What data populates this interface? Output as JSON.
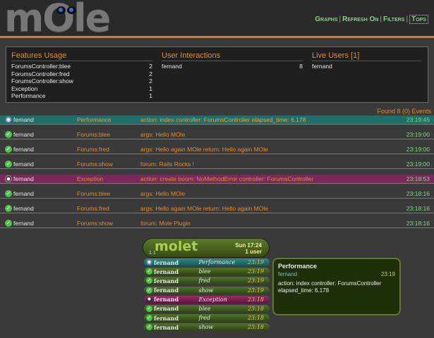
{
  "header": {
    "logo": "mOle",
    "nav": [
      "Graphs",
      "Refresh On",
      "Filters",
      "Tops"
    ]
  },
  "summary": {
    "features": {
      "title": "Features Usage",
      "items": [
        {
          "name": "ForumsController:blee",
          "count": "2"
        },
        {
          "name": "ForumsController:fred",
          "count": "2"
        },
        {
          "name": "ForumsController:show",
          "count": "2"
        },
        {
          "name": "Exception",
          "count": "1"
        },
        {
          "name": "Performance",
          "count": "1"
        }
      ]
    },
    "interactions": {
      "title": "User Interactions",
      "items": [
        {
          "name": "fernand",
          "count": "8"
        }
      ]
    },
    "live": {
      "title": "Live Users [1]",
      "items": [
        {
          "name": "fernand"
        }
      ]
    }
  },
  "found": "Found 8 (0) Events",
  "events": [
    {
      "kind": "perf",
      "user": "fernand",
      "type": "Performance",
      "msg": "action: index controller: ForumsController elapsed_time: 6.178",
      "time": "23:19:45"
    },
    {
      "kind": "ok",
      "user": "fernand",
      "type": "Forums:blee",
      "msg": "args: Hello MOle",
      "time": "23:19:00"
    },
    {
      "kind": "ok",
      "user": "fernand",
      "type": "Forums:fred",
      "msg": "args: Hello again MOle return: Hello again MOle",
      "time": "23:19:00"
    },
    {
      "kind": "ok",
      "user": "fernand",
      "type": "Forums:show",
      "msg": "forum: Rails Rocks !",
      "time": "23:19:00"
    },
    {
      "kind": "exc",
      "user": "fernand",
      "type": "Exception",
      "msg": "action: create boom: NoMethodError controller: ForumsController",
      "time": "23:18:53"
    },
    {
      "kind": "ok",
      "user": "fernand",
      "type": "Forums:blee",
      "msg": "args: Hello MOle",
      "time": "23:18:16"
    },
    {
      "kind": "ok",
      "user": "fernand",
      "type": "Forums:fred",
      "msg": "args: Hello again MOle return: Hello again MOle",
      "time": "23:18:16"
    },
    {
      "kind": "ok",
      "user": "fernand",
      "type": "Forums:show",
      "msg": "forum: Mole Plugin",
      "time": "23:18:16"
    }
  ],
  "molet": {
    "title": "molet",
    "version": "1.1",
    "time": "Sun 17:24",
    "users": "1 user",
    "rows": [
      {
        "kind": "perf",
        "user": "fernand",
        "type": "Performance",
        "time": "23:19"
      },
      {
        "kind": "ok",
        "user": "fernand",
        "type": "blee",
        "time": "23:19"
      },
      {
        "kind": "ok",
        "user": "fernand",
        "type": "fred",
        "time": "23:19"
      },
      {
        "kind": "ok",
        "user": "fernand",
        "type": "show",
        "time": "23:19"
      },
      {
        "kind": "exc",
        "user": "fernand",
        "type": "Exception",
        "time": "23:18"
      },
      {
        "kind": "ok",
        "user": "fernand",
        "type": "blee",
        "time": "23:18"
      },
      {
        "kind": "ok",
        "user": "fernand",
        "type": "fred",
        "time": "23:18"
      },
      {
        "kind": "ok",
        "user": "fernand",
        "type": "show",
        "time": "23:18"
      }
    ],
    "detail": {
      "title": "Performance",
      "user": "fernand",
      "time": "23:19",
      "body": "action: index controller: ForumsController elapsed_time: 6.178"
    }
  },
  "icons": {
    "ok": "check-circle-icon",
    "perf": "globe-icon",
    "exc": "bomb-icon"
  },
  "colors": {
    "accent": "#e58a2c",
    "link": "#7bdc7b",
    "perf_row": "#1f6e6a",
    "exception_row": "#7a2a5a"
  }
}
